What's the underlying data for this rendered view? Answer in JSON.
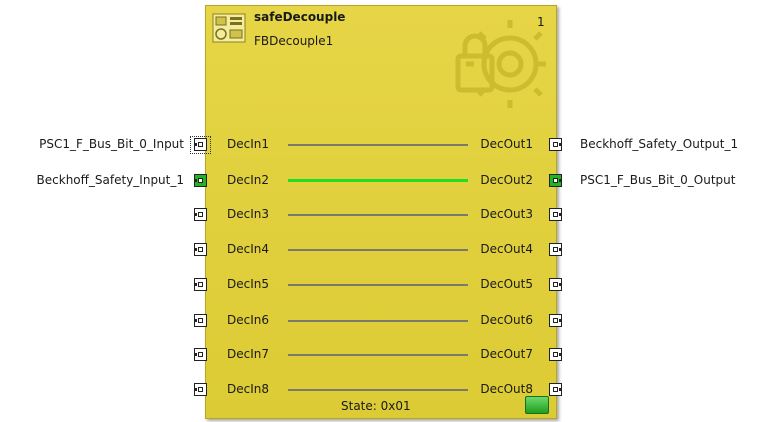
{
  "block": {
    "type_name": "safeDecouple",
    "instance_name": "FBDecouple1",
    "index": "1",
    "state": "State: 0x01"
  },
  "inputs": [
    {
      "pin": "DecIn1",
      "signal": "PSC1_F_Bus_Bit_0_Input",
      "active": false
    },
    {
      "pin": "DecIn2",
      "signal": "Beckhoff_Safety_Input_1",
      "active": true
    },
    {
      "pin": "DecIn3",
      "signal": "",
      "active": false
    },
    {
      "pin": "DecIn4",
      "signal": "",
      "active": false
    },
    {
      "pin": "DecIn5",
      "signal": "",
      "active": false
    },
    {
      "pin": "DecIn6",
      "signal": "",
      "active": false
    },
    {
      "pin": "DecIn7",
      "signal": "",
      "active": false
    },
    {
      "pin": "DecIn8",
      "signal": "",
      "active": false
    }
  ],
  "outputs": [
    {
      "pin": "DecOut1",
      "signal": "Beckhoff_Safety_Output_1",
      "active": false
    },
    {
      "pin": "DecOut2",
      "signal": "PSC1_F_Bus_Bit_0_Output",
      "active": true
    },
    {
      "pin": "DecOut3",
      "signal": "",
      "active": false
    },
    {
      "pin": "DecOut4",
      "signal": "",
      "active": false
    },
    {
      "pin": "DecOut5",
      "signal": "",
      "active": false
    },
    {
      "pin": "DecOut6",
      "signal": "",
      "active": false
    },
    {
      "pin": "DecOut7",
      "signal": "",
      "active": false
    },
    {
      "pin": "DecOut8",
      "signal": "",
      "active": false
    }
  ],
  "colors": {
    "block_fill": "#dccb34",
    "active_signal": "#22dd22",
    "active_port": "#22b522"
  },
  "icons": [
    "function-block-icon",
    "safety-gear-lock-watermark-icon",
    "status-led-icon"
  ]
}
